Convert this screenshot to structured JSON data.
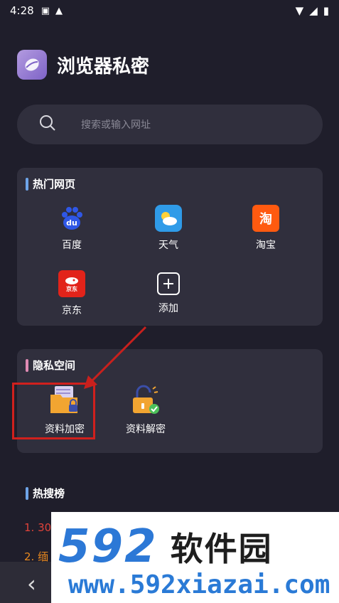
{
  "status_bar": {
    "time": "4:28",
    "icons": [
      "a-box-icon",
      "warning-icon",
      "wifi-icon",
      "signal-icon",
      "battery-icon"
    ]
  },
  "app": {
    "title": "浏览器私密"
  },
  "search": {
    "placeholder": "搜索或输入网址"
  },
  "hot_pages": {
    "title": "热门网页",
    "bar_color": "#6ea4e8",
    "items": [
      {
        "label": "百度",
        "icon": "baidu-icon",
        "color": "#2f57e6"
      },
      {
        "label": "天气",
        "icon": "weather-icon",
        "color": "#2f9be8"
      },
      {
        "label": "淘宝",
        "icon": "taobao-icon",
        "color": "#ff5a10",
        "glyph": "淘"
      },
      {
        "label": "京东",
        "icon": "jd-icon",
        "color": "#e2231a",
        "glyph": "京东"
      },
      {
        "label": "添加",
        "icon": "add-icon"
      }
    ]
  },
  "private_space": {
    "title": "隐私空间",
    "bar_color": "#e08ab4",
    "items": [
      {
        "label": "资料加密",
        "icon": "folder-lock-icon"
      },
      {
        "label": "资料解密",
        "icon": "unlock-icon"
      }
    ]
  },
  "hot_search": {
    "title": "热搜榜",
    "bar_color": "#6ea4e8",
    "items": [
      "1. 30",
      "2. 缅"
    ]
  },
  "watermark": {
    "number": "592",
    "brand": "软件园",
    "url": "www.592xiazai.com"
  },
  "colors": {
    "background": "#1f1e2b",
    "card": "#302f3d",
    "accent_red": "#d0201d",
    "hot_search_red": "#e0433a"
  }
}
